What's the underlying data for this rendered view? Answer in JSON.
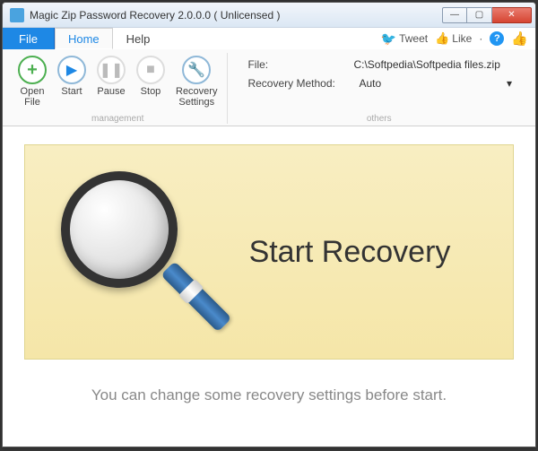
{
  "window": {
    "title": "Magic Zip Password Recovery 2.0.0.0  ( Unlicensed )"
  },
  "tabs": {
    "file": "File",
    "home": "Home",
    "help": "Help"
  },
  "social": {
    "tweet": "Tweet",
    "like": "Like"
  },
  "ribbon": {
    "open": "Open\nFile",
    "start": "Start",
    "pause": "Pause",
    "stop": "Stop",
    "settings": "Recovery\nSettings",
    "group_management": "management",
    "group_others": "others"
  },
  "file_panel": {
    "file_label": "File:",
    "file_value": "C:\\Softpedia\\Softpedia files.zip",
    "method_label": "Recovery Method:",
    "method_value": "Auto"
  },
  "banner": {
    "heading": "Start Recovery"
  },
  "hint": "You can change some recovery settings before start."
}
